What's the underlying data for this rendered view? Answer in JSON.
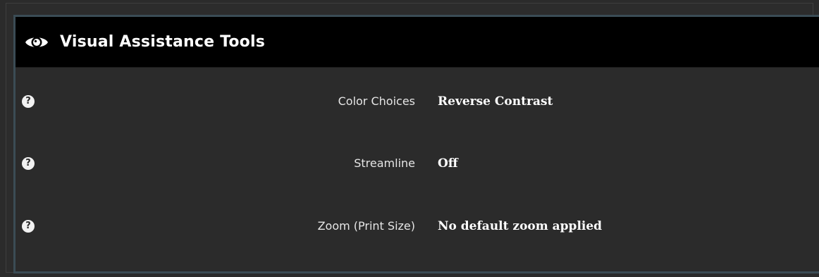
{
  "panel": {
    "title": "Visual Assistance Tools",
    "title_icon": "eye-icon"
  },
  "settings": [
    {
      "label": "Color Choices",
      "value": "Reverse Contrast",
      "help_icon": "help-icon",
      "help_glyph": "?"
    },
    {
      "label": "Streamline",
      "value": "Off",
      "help_icon": "help-icon",
      "help_glyph": "?"
    },
    {
      "label": "Zoom (Print Size)",
      "value": "No default zoom applied",
      "help_icon": "help-icon",
      "help_glyph": "?"
    }
  ],
  "colors": {
    "header_bg": "#000000",
    "panel_bg": "#2b2b2b",
    "border": "#3b4c55",
    "text": "#ffffff"
  }
}
